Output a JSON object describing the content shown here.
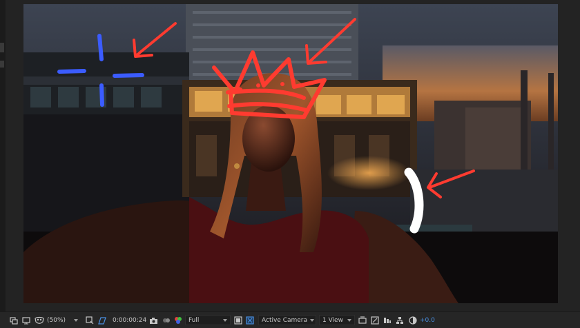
{
  "toolbar": {
    "zoom_level": "(50%)",
    "timecode": "0:00:00:24",
    "resolution": "Full",
    "camera": "Active Camera",
    "views": "1 View",
    "exposure": "+0.0"
  },
  "icons": {
    "always_preview": "monitor-stack-icon",
    "mask_visibility": "mask-icon",
    "region_of_interest": "roi-icon",
    "transparency_grid": "checkerboard-icon",
    "snapshot": "camera-icon",
    "show_snapshot": "show-snapshot-icon",
    "channel": "color-channel-icon",
    "fast_previews": "fast-preview-icon",
    "draft_3d": "draft-3d-icon",
    "reset_exposure": "reset-exposure-icon"
  },
  "colors": {
    "panel_background": "#232323",
    "accent_blue": "#4a90e2",
    "annotation_red": "#ff3b30",
    "annotation_blue": "#3b5cff",
    "annotation_white": "#ffffff"
  }
}
